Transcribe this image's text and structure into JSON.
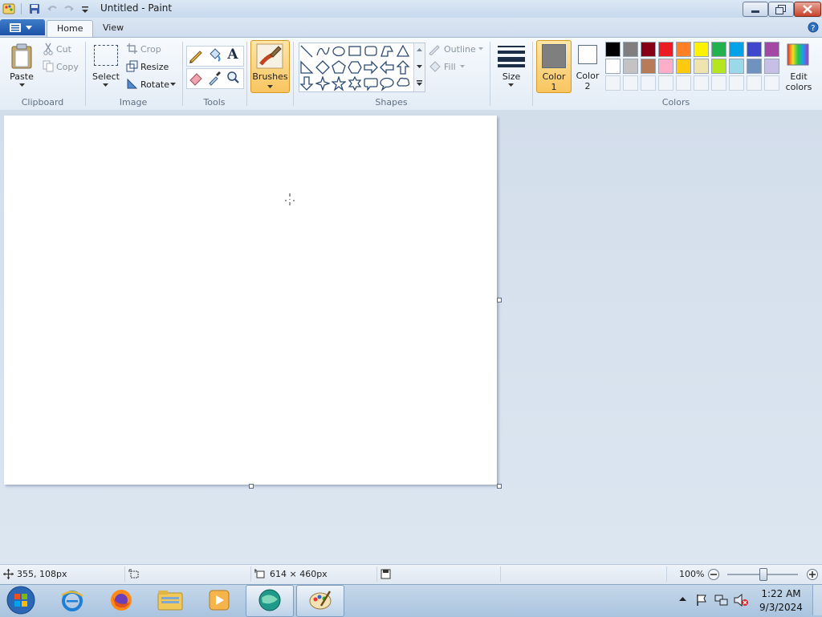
{
  "window": {
    "title": "Untitled - Paint"
  },
  "tabs": [
    {
      "label": "Home"
    },
    {
      "label": "View"
    }
  ],
  "clipboard": {
    "paste": "Paste",
    "cut": "Cut",
    "copy": "Copy",
    "group": "Clipboard"
  },
  "image": {
    "select": "Select",
    "crop": "Crop",
    "resize": "Resize",
    "rotate": "Rotate",
    "group": "Image"
  },
  "tools": {
    "group": "Tools",
    "text_glyph": "A"
  },
  "brushes": {
    "label": "Brushes"
  },
  "shapes": {
    "group": "Shapes",
    "outline": "Outline",
    "fill": "Fill"
  },
  "size": {
    "label": "Size"
  },
  "colors": {
    "group": "Colors",
    "color1": {
      "label": "Color",
      "num": "1",
      "value": "#7f7f7f"
    },
    "color2": {
      "label": "Color",
      "num": "2",
      "value": "#ffffff"
    },
    "edit": {
      "line1": "Edit",
      "line2": "colors"
    },
    "palette_row1": [
      "#000000",
      "#7f7f7f",
      "#880015",
      "#ed1c24",
      "#ff7f27",
      "#fff200",
      "#22b14c",
      "#00a2e8",
      "#3f48cc",
      "#a349a4"
    ],
    "palette_row2": [
      "#ffffff",
      "#c3c3c3",
      "#b97a57",
      "#ffaec9",
      "#ffc90e",
      "#efe4b0",
      "#b5e61d",
      "#99d9ea",
      "#7092be",
      "#c8bfe7"
    ]
  },
  "status": {
    "cursor_pos": "355, 108px",
    "canvas_size": "614 × 460px",
    "zoom": "100%",
    "zoom_level": 0.5
  },
  "taskbar": {
    "time": "1:22 AM",
    "date": "9/3/2024"
  }
}
